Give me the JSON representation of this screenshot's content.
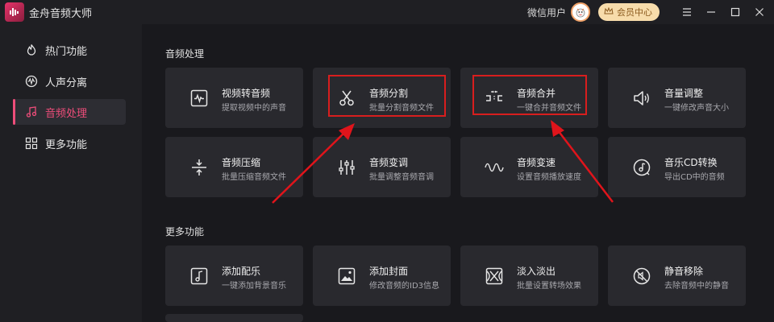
{
  "app": {
    "title": "金舟音频大师",
    "user": "微信用户",
    "vip_label": "会员中心"
  },
  "sidebar": {
    "items": [
      {
        "label": "热门功能",
        "icon": "hot-icon"
      },
      {
        "label": "人声分离",
        "icon": "waveform-circle-icon"
      },
      {
        "label": "音频处理",
        "icon": "music-note-icon",
        "active": true
      },
      {
        "label": "更多功能",
        "icon": "grid-icon"
      }
    ]
  },
  "sections": [
    {
      "title": "音频处理",
      "cards": [
        {
          "title": "视频转音频",
          "subtitle": "提取视频中的声音",
          "icon": "video-to-audio-icon"
        },
        {
          "title": "音频分割",
          "subtitle": "批量分割音频文件",
          "icon": "scissors-icon"
        },
        {
          "title": "音频合并",
          "subtitle": "一键合并音频文件",
          "icon": "merge-icon"
        },
        {
          "title": "音量调整",
          "subtitle": "一键修改声音大小",
          "icon": "volume-icon"
        },
        {
          "title": "音频压缩",
          "subtitle": "批量压缩音频文件",
          "icon": "compress-icon"
        },
        {
          "title": "音频变调",
          "subtitle": "批量调整音频音调",
          "icon": "sliders-icon"
        },
        {
          "title": "音频变速",
          "subtitle": "设置音频播放速度",
          "icon": "wave-icon"
        },
        {
          "title": "音乐CD转换",
          "subtitle": "导出CD中的音频",
          "icon": "cd-icon"
        }
      ]
    },
    {
      "title": "更多功能",
      "cards": [
        {
          "title": "添加配乐",
          "subtitle": "一键添加背景音乐",
          "icon": "add-music-icon"
        },
        {
          "title": "添加封面",
          "subtitle": "修改音频的ID3信息",
          "icon": "cover-image-icon"
        },
        {
          "title": "淡入淡出",
          "subtitle": "批量设置转场效果",
          "icon": "fade-icon"
        },
        {
          "title": "静音移除",
          "subtitle": "去除音频中的静音",
          "icon": "mute-remove-icon"
        }
      ]
    }
  ],
  "colors": {
    "accent": "#ee4d7a",
    "highlight": "#d81e1e",
    "vip_bg": "#f7dcab"
  }
}
